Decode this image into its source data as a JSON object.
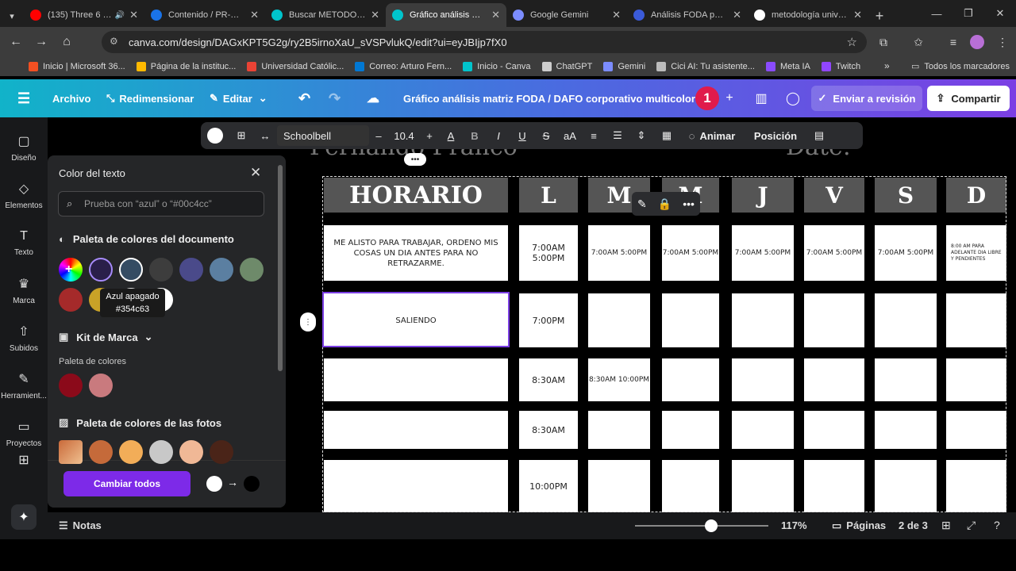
{
  "browser": {
    "tabs": [
      {
        "title": "(135) Three 6 Ma",
        "color": "#ff0000",
        "active": false,
        "sound": true
      },
      {
        "title": "Contenido / PR-METO",
        "color": "#1a73e8",
        "active": false,
        "sound": false
      },
      {
        "title": "Buscar METODOLOG",
        "color": "#00c4cc",
        "active": false,
        "sound": false
      },
      {
        "title": "Gráfico análisis matr",
        "color": "#00c4cc",
        "active": true,
        "sound": false
      },
      {
        "title": "Google Gemini",
        "color": "#7b8cff",
        "active": false,
        "sound": false
      },
      {
        "title": "Análisis FODA para h",
        "color": "#3b5bd9",
        "active": false,
        "sound": false
      },
      {
        "title": "metodología univers",
        "color": "#ffffff",
        "active": false,
        "sound": false
      }
    ],
    "url": "canva.com/design/DAGxKPT5G2g/ry2B5irnoXaU_sVSPvlukQ/edit?ui=eyJBIjp7fX0",
    "bookmarks": [
      {
        "label": "Inicio | Microsoft 36...",
        "color": "#f25022"
      },
      {
        "label": "Página de la instituc...",
        "color": "#ffb900"
      },
      {
        "label": "Universidad Católic...",
        "color": "#ea4335"
      },
      {
        "label": "Correo: Arturo Fern...",
        "color": "#0078d4"
      },
      {
        "label": "Inicio - Canva",
        "color": "#00c4cc"
      },
      {
        "label": "ChatGPT",
        "color": "#cccccc"
      },
      {
        "label": "Gemini",
        "color": "#7b8cff"
      },
      {
        "label": "Cici AI: Tu asistente...",
        "color": "#bbbbbb"
      },
      {
        "label": "Meta IA",
        "color": "#8a4bff"
      },
      {
        "label": "Twitch",
        "color": "#9146ff"
      }
    ],
    "all_bookmarks": "Todos los marcadores"
  },
  "header": {
    "menu": [
      "Archivo",
      "Redimensionar",
      "Editar"
    ],
    "title": "Gráfico análisis matriz FODA / DAFO corporativo multicolor ...",
    "avatar": "1",
    "send_review": "Enviar a revisión",
    "share": "Compartir"
  },
  "rail": [
    "Diseño",
    "Elementos",
    "Texto",
    "Marca",
    "Subidos",
    "Herramient...",
    "Proyectos"
  ],
  "panel": {
    "title": "Color del texto",
    "search_placeholder": "Prueba con “azul” o “#00c4cc”",
    "doc_palette": "Paleta de colores del documento",
    "doc_colors": [
      "#3d3d3d",
      "#4a4a8a",
      "#5b7fa1",
      "#6e8a6a",
      "#a52a2a",
      "#c9a227",
      "#e0e0e0",
      "#ffffff"
    ],
    "tooltip_name": "Azul apagado",
    "tooltip_hex": "#354c63",
    "brand_kit": "Kit de Marca",
    "brand_palette": "Paleta de colores",
    "brand_colors": [
      "#8b0a1a",
      "#c97a7e"
    ],
    "photo_palette": "Paleta de colores de las fotos",
    "photo_colors": [
      "#c56a3a",
      "#f2ad58",
      "#c8c8c8",
      "#f0b896",
      "#4a2418"
    ],
    "change_all": "Cambiar todos"
  },
  "toolbar": {
    "font": "Schoolbell",
    "size": "10.4",
    "animate": "Animar",
    "position": "Posición"
  },
  "canvas": {
    "name": "Fernando Franco",
    "date": "Date:",
    "header": [
      "HORARIO",
      "L",
      "M",
      "M",
      "J",
      "V",
      "S",
      "D"
    ],
    "rows": [
      [
        "ME ALISTO PARA TRABAJAR, ORDENO MIS COSAS UN DIA ANTES PARA NO RETRAZARME.",
        "7:00AM 5:00PM",
        "7:00AM 5:00PM",
        "7:00AM 5:00PM",
        "7:00AM 5:00PM",
        "7:00AM 5:00PM",
        "7:00AM 5:00PM",
        "8:00 AM PARA ADELANTE DIA LIBRE Y PENDIENTES"
      ],
      [
        "SALIENDO",
        "7:00PM",
        "",
        "",
        "",
        "",
        "",
        ""
      ],
      [
        "",
        "8:30AM",
        "8:30AM 10:00PM",
        "",
        "",
        "",
        "",
        ""
      ],
      [
        "",
        "8:30AM",
        "",
        "",
        "",
        "",
        "",
        ""
      ],
      [
        "",
        "10:00PM",
        "",
        "",
        "",
        "",
        "",
        ""
      ]
    ]
  },
  "bottom": {
    "notes": "Notas",
    "zoom": "117%",
    "zoom_fraction": 0.57,
    "pages": "Páginas",
    "page_of": "2 de 3"
  }
}
